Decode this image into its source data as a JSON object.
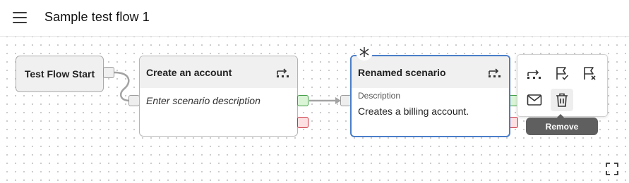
{
  "header": {
    "title": "Sample test flow 1",
    "menu_icon": "hamburger-menu-icon"
  },
  "flow": {
    "start_node": {
      "label": "Test Flow Start"
    },
    "nodes": [
      {
        "title": "Create an account",
        "description_placeholder": "Enter scenario description",
        "icon": "scenario-flow-icon"
      },
      {
        "title": "Renamed scenario",
        "description_label": "Description",
        "description": "Creates a billing account.",
        "icon": "scenario-flow-icon",
        "selected": true,
        "badge_icon": "asterisk-icon"
      }
    ],
    "port_colors": {
      "success": "#d9f5d6",
      "failure": "#fde0e2",
      "neutral": "#eeeeee"
    },
    "selection_color": "#4a7ec9"
  },
  "toolbar": {
    "buttons": [
      {
        "icon": "scenario-flow-icon"
      },
      {
        "icon": "flag-check-icon"
      },
      {
        "icon": "flag-x-icon"
      },
      {
        "icon": "mail-icon"
      },
      {
        "icon": "trash-icon"
      }
    ],
    "tooltip": "Remove"
  },
  "canvas_controls": {
    "fullscreen_icon": "fullscreen-icon"
  }
}
